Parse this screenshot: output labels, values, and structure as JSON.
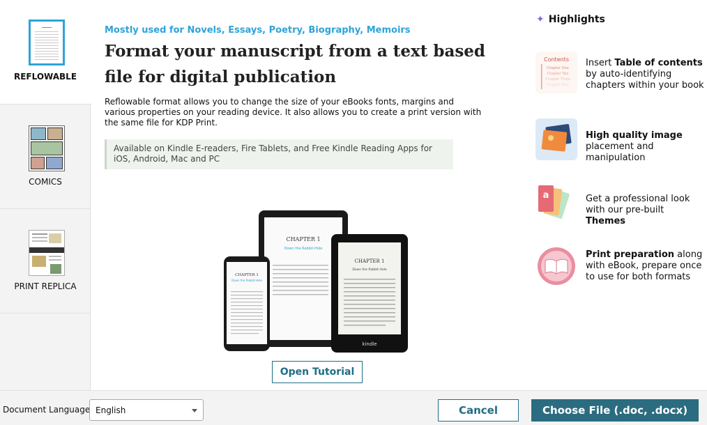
{
  "sidebar": {
    "items": [
      {
        "label": "REFLOWABLE"
      },
      {
        "label": "COMICS"
      },
      {
        "label": "PRINT REPLICA"
      }
    ]
  },
  "main": {
    "subtitle": "Mostly used for Novels, Essays, Poetry, Biography, Memoirs",
    "title": "Format your manuscript from a text based file for digital publication",
    "description": "Reflowable format allows you to change the size of your eBooks fonts, margins and various properties on your reading device. It also allows you to create a print version with the same file for KDP Print.",
    "availability": "Available on Kindle E-readers, Fire Tablets, and Free Kindle Reading Apps for iOS, Android, Mac and PC",
    "devices": {
      "chapter": "CHAPTER 1",
      "chapter_subtitle": "Down the Rabbit-Hole",
      "brand": "kindle"
    },
    "tutorial_button": "Open Tutorial"
  },
  "highlights": {
    "title": "Highlights",
    "icon_contents": {
      "heading": "Contents",
      "lines": [
        "Chapter One",
        "Chapter Two",
        "Chapter Three",
        "Chapter Four"
      ]
    },
    "items": [
      {
        "pre": "Insert ",
        "bold": "Table of contents",
        "post": " by auto-identifying chapters within your book",
        "icon": "table-of-contents-icon"
      },
      {
        "pre": "",
        "bold": "High quality image",
        "post": " placement and manipulation",
        "icon": "image-icon"
      },
      {
        "pre": "Get a professional look with our pre-built ",
        "bold": "Themes",
        "post": "",
        "icon": "themes-icon"
      },
      {
        "pre": "",
        "bold": "Print preparation",
        "post": " along with eBook, prepare once to use for both formats",
        "icon": "book-icon"
      }
    ],
    "colors": {
      "accent": "#2ea3d8",
      "primary_button": "#2b6c80",
      "sparkle": "#7a6ae0"
    }
  },
  "footer": {
    "language_label": "Document Language",
    "language_value": "English",
    "cancel_label": "Cancel",
    "choose_label": "Choose File  (.doc, .docx)"
  }
}
